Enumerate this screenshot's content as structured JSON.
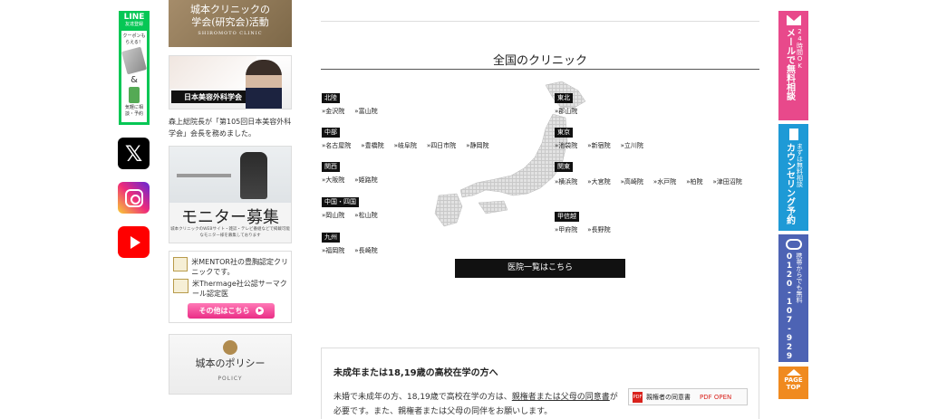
{
  "social": {
    "line": {
      "title": "LINE",
      "subtitle": "友達登録",
      "coupon": "クーポンもらえる！",
      "amp": "&",
      "consult": "気軽に相談・予約"
    },
    "x_label": "𝕏"
  },
  "sidebar": {
    "society_banner": {
      "line1": "城本クリニックの",
      "line2": "学会(研究会)活動",
      "line3": "SHIROMOTO CLINIC"
    },
    "photo_banner": {
      "sign": "日本美容外科学会"
    },
    "caption": "森上総院長が「第105回日本美容外科学会」会長を務めました。",
    "monitor_banner": {
      "title": "モニター募集",
      "subtitle": "城本クリニックのWEBサイト・雑誌・テレビ番組などで掲載可能なモニター様を募集しております"
    },
    "certs": [
      {
        "text": "米MENTOR社の豊胸認定クリニックです。"
      },
      {
        "text": "米Thermage社公認サーマクール認定医"
      }
    ],
    "more_button": "その他はこちら",
    "policy": {
      "title": "城本のポリシー",
      "subtitle": "POLICY"
    }
  },
  "main": {
    "heading": "全国のクリニック",
    "regions": [
      {
        "name": "北陸",
        "clinics": [
          "金沢院",
          "富山院"
        ]
      },
      {
        "name": "中部",
        "clinics": [
          "名古屋院",
          "豊橋院",
          "岐阜院",
          "四日市院",
          "静岡院"
        ]
      },
      {
        "name": "関西",
        "clinics": [
          "大阪院",
          "姫路院"
        ]
      },
      {
        "name": "中国・四国",
        "clinics": [
          "岡山院",
          "松山院"
        ]
      },
      {
        "name": "九州",
        "clinics": [
          "福岡院",
          "長崎院"
        ]
      },
      {
        "name": "東北",
        "clinics": [
          "郡山院"
        ]
      },
      {
        "name": "東京",
        "clinics": [
          "池袋院",
          "新宿院",
          "立川院"
        ]
      },
      {
        "name": "関東",
        "clinics": [
          "横浜院",
          "大宮院",
          "高崎院",
          "水戸院",
          "柏院",
          "津田沼院"
        ]
      },
      {
        "name": "甲信越",
        "clinics": [
          "甲府院",
          "長野院"
        ]
      }
    ],
    "list_button": "医院一覧はこちら",
    "minor": {
      "title": "未成年または18,19歳の高校在学の方へ",
      "text_before": "未婚で未成年の方、18,19歳で高校在学の方は、",
      "link": "親権者または父母の同意書",
      "text_after": "が必要です。また、親権者または父母の同伴をお願いします。",
      "pdf_label": "親権者の同意書",
      "pdf_icon": "PDF",
      "pdf_open": "PDF OPEN"
    }
  },
  "floating": {
    "mail": {
      "sub": "24時間OK",
      "main": "メールで無料相談"
    },
    "counsel": {
      "sub": "まずは無料相談",
      "main": "カウンセリング予約"
    },
    "tel": {
      "sub": "携帯からでも無料",
      "main": "0120-107-929"
    },
    "top": {
      "line1": "PAGE",
      "line2": "TOP"
    }
  }
}
